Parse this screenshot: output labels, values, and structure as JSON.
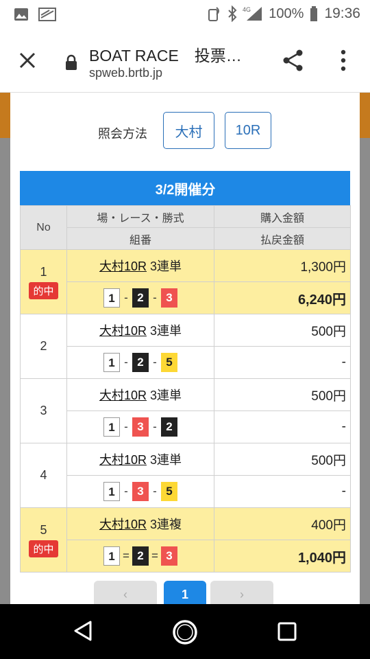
{
  "status_bar": {
    "network": "4G",
    "battery": "100%",
    "time": "19:36"
  },
  "browser": {
    "title": "BOAT RACE　投票…",
    "host": "spweb.brtb.jp"
  },
  "filter": {
    "label": "照会方法",
    "place": "大村",
    "race": "10R"
  },
  "table": {
    "date_header": "3/2開催分",
    "headers": {
      "no": "No",
      "race_type": "場・レース・勝式",
      "purchase": "購入金額",
      "combo": "組番",
      "payout": "払戻金額"
    },
    "hit_label": "的中",
    "rows": [
      {
        "no": "1",
        "hit": true,
        "race": "大村10R",
        "bet_type": "3連単",
        "boats": [
          "1",
          "2",
          "3"
        ],
        "sep": "-",
        "purchase": "1,300円",
        "payout": "6,240円"
      },
      {
        "no": "2",
        "hit": false,
        "race": "大村10R",
        "bet_type": "3連単",
        "boats": [
          "1",
          "2",
          "5"
        ],
        "sep": "-",
        "purchase": "500円",
        "payout": "-"
      },
      {
        "no": "3",
        "hit": false,
        "race": "大村10R",
        "bet_type": "3連単",
        "boats": [
          "1",
          "3",
          "2"
        ],
        "sep": "-",
        "purchase": "500円",
        "payout": "-"
      },
      {
        "no": "4",
        "hit": false,
        "race": "大村10R",
        "bet_type": "3連単",
        "boats": [
          "1",
          "3",
          "5"
        ],
        "sep": "-",
        "purchase": "500円",
        "payout": "-"
      },
      {
        "no": "5",
        "hit": true,
        "race": "大村10R",
        "bet_type": "3連複",
        "boats": [
          "1",
          "2",
          "3"
        ],
        "sep": "=",
        "purchase": "400円",
        "payout": "1,040円"
      }
    ]
  },
  "pager": {
    "current": "1",
    "prev": "‹",
    "next": "›"
  },
  "colors": {
    "accent": "#1e88e5",
    "hit_bg": "#fdeea0",
    "hit_badge": "#e53935"
  }
}
